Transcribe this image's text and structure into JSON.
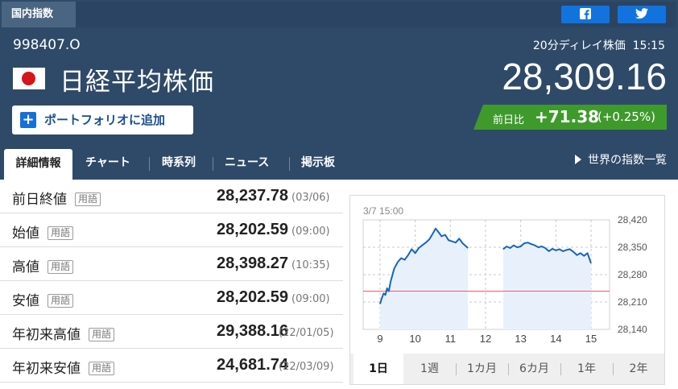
{
  "header": {
    "category_tab": "国内指数",
    "code": "998407.O",
    "name": "日経平均株価",
    "portfolio_label": "ポートフォリオに追加",
    "delay_label": "20分ディレイ株価",
    "time": "15:15",
    "price": "28,309.16",
    "change_label": "前日比",
    "change_amount": "+71.38",
    "change_percent": "(+0.25%)"
  },
  "share": {
    "facebook": "facebook-icon",
    "twitter": "twitter-icon"
  },
  "colors": {
    "header_bg": "#2f4a68",
    "positive": "#3f9a2c",
    "chart_line": "#1565c0",
    "chart_fill": "#e8f1fb",
    "prev_close_line": "#e06070"
  },
  "tabs": [
    "詳細情報",
    "チャート",
    "時系列",
    "ニュース",
    "掲示板"
  ],
  "world_link": "世界の指数一覧",
  "yogo_label": "用語",
  "stats": [
    {
      "label": "前日終値",
      "value": "28,237.78",
      "date": "(03/06)"
    },
    {
      "label": "始値",
      "value": "28,202.59",
      "date": "(09:00)"
    },
    {
      "label": "高値",
      "value": "28,398.27",
      "date": "(10:35)"
    },
    {
      "label": "安値",
      "value": "28,202.59",
      "date": "(09:00)"
    },
    {
      "label": "年初来高値",
      "value": "29,388.16",
      "date": "(22/01/05)"
    },
    {
      "label": "年初来安値",
      "value": "24,681.74",
      "date": "(22/03/09)"
    }
  ],
  "periods": [
    "1日",
    "1週",
    "1カ月",
    "6カ月",
    "1年",
    "2年"
  ],
  "chart_data": {
    "type": "line",
    "title": "3/7 15:00",
    "x_ticks": [
      "9",
      "10",
      "11",
      "12",
      "13",
      "14",
      "15"
    ],
    "y_ticks": [
      "28,420",
      "28,350",
      "28,280",
      "28,210",
      "28,140"
    ],
    "ylim": [
      28140,
      28420
    ],
    "xlim": [
      9,
      15
    ],
    "reference_line": 28237.78,
    "grid": true,
    "series": [
      {
        "session": "morning",
        "x": [
          9.0,
          9.05,
          9.1,
          9.15,
          9.2,
          9.25,
          9.3,
          9.4,
          9.5,
          9.6,
          9.7,
          9.8,
          9.9,
          10.0,
          10.1,
          10.2,
          10.3,
          10.4,
          10.5,
          10.58,
          10.65,
          10.75,
          10.85,
          10.95,
          11.05,
          11.15,
          11.25,
          11.35,
          11.5
        ],
        "y": [
          28205,
          28220,
          28232,
          28228,
          28245,
          28238,
          28262,
          28295,
          28312,
          28322,
          28318,
          28330,
          28345,
          28335,
          28348,
          28355,
          28362,
          28370,
          28385,
          28398,
          28390,
          28378,
          28382,
          28368,
          28365,
          28362,
          28372,
          28360,
          28348
        ]
      },
      {
        "session": "afternoon",
        "x": [
          12.5,
          12.6,
          12.7,
          12.8,
          12.9,
          13.0,
          13.1,
          13.2,
          13.3,
          13.4,
          13.5,
          13.6,
          13.7,
          13.8,
          13.9,
          14.0,
          14.1,
          14.2,
          14.3,
          14.4,
          14.5,
          14.6,
          14.7,
          14.8,
          14.9,
          15.0
        ],
        "y": [
          28345,
          28352,
          28348,
          28355,
          28350,
          28352,
          28360,
          28362,
          28358,
          28355,
          28350,
          28352,
          28348,
          28340,
          28346,
          28342,
          28345,
          28340,
          28343,
          28345,
          28338,
          28330,
          28335,
          28328,
          28335,
          28309
        ]
      }
    ]
  }
}
